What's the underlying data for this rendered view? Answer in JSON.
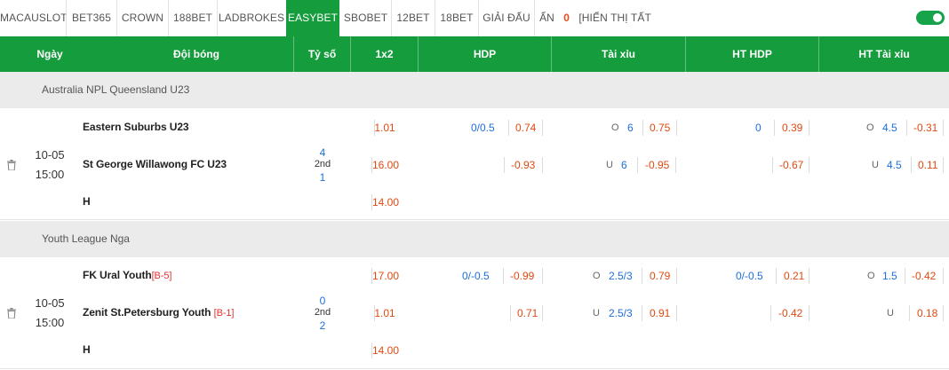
{
  "tabs": [
    {
      "label": "MACAUSLOT",
      "active": false
    },
    {
      "label": "BET365",
      "active": false
    },
    {
      "label": "CROWN",
      "active": false
    },
    {
      "label": "188BET",
      "active": false
    },
    {
      "label": "LADBROKES",
      "active": false
    },
    {
      "label": "EASYBET",
      "active": true
    },
    {
      "label": "SBOBET",
      "active": false
    },
    {
      "label": "12BET",
      "active": false
    },
    {
      "label": "18BET",
      "active": false
    },
    {
      "label": "GIẢI ĐẤU",
      "active": false
    }
  ],
  "hide": {
    "prefix": "ẨN",
    "count": "0",
    "show_all": "[HIỂN THỊ TẤT CẢ]"
  },
  "toggle_on": true,
  "headers": [
    "Ngày",
    "Đội bóng",
    "Tỷ số",
    "1x2",
    "HDP",
    "Tài xỉu",
    "HT HDP",
    "HT Tài xỉu"
  ],
  "colors": {
    "green": "#159c3c",
    "odd_red": "#e04a12",
    "odd_blue": "#1e6fd9"
  },
  "leagues": [
    {
      "name": "Australia NPL Queensland U23",
      "match": {
        "date": "10-05",
        "time": "15:00",
        "home": "Eastern Suburbs U23",
        "home_rank": "",
        "away": "St George Willawong FC U23",
        "away_rank": "",
        "draw_label": "H",
        "score_home": "4",
        "status": "2nd",
        "score_away": "1",
        "x12": [
          "1.01",
          "16.00",
          "14.00"
        ],
        "hdp": {
          "line": "0/0.5",
          "home": "0.74",
          "away": "-0.93"
        },
        "ou": {
          "o_label": "O",
          "o_line": "6",
          "o_odd": "0.75",
          "u_label": "U",
          "u_line": "6",
          "u_odd": "-0.95"
        },
        "ht_hdp": {
          "line": "0",
          "home": "0.39",
          "away": "-0.67"
        },
        "ht_ou": {
          "o_label": "O",
          "o_line": "4.5",
          "o_odd": "-0.31",
          "u_label": "U",
          "u_line": "4.5",
          "u_odd": "0.11"
        }
      }
    },
    {
      "name": "Youth League Nga",
      "match": {
        "date": "10-05",
        "time": "15:00",
        "home": "FK Ural Youth",
        "home_rank": "[B-5]",
        "away": "Zenit St.Petersburg Youth",
        "away_rank": "[B-1]",
        "draw_label": "H",
        "score_home": "0",
        "status": "2nd",
        "score_away": "2",
        "x12": [
          "17.00",
          "1.01",
          "14.00"
        ],
        "hdp": {
          "line": "0/-0.5",
          "home": "-0.99",
          "away": "0.71"
        },
        "ou": {
          "o_label": "O",
          "o_line": "2.5/3",
          "o_odd": "0.79",
          "u_label": "U",
          "u_line": "2.5/3",
          "u_odd": "0.91"
        },
        "ht_hdp": {
          "line": "0/-0.5",
          "home": "0.21",
          "away": "-0.42"
        },
        "ht_ou": {
          "o_label": "O",
          "o_line": "1.5",
          "o_odd": "-0.42",
          "u_label": "U",
          "u_line": "",
          "u_odd": "0.18"
        }
      }
    }
  ]
}
